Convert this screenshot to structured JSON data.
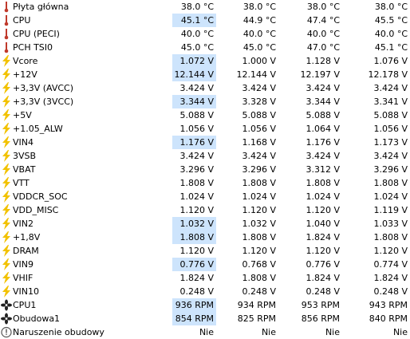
{
  "colors": {
    "highlight": "#cde4fc",
    "temperature_icon": "#c0392b",
    "voltage_icon": "#f2c200",
    "fan_icon": "#222222"
  },
  "rows": [
    {
      "name": "Płyta główna",
      "icon": "thermometer-icon",
      "highlighted": false,
      "values": [
        "38.0 °C",
        "38.0 °C",
        "38.0 °C",
        "38.0 °C"
      ]
    },
    {
      "name": "CPU",
      "icon": "thermometer-icon",
      "highlighted": true,
      "values": [
        "45.1 °C",
        "44.9 °C",
        "47.4 °C",
        "45.5 °C"
      ]
    },
    {
      "name": "CPU (PECI)",
      "icon": "thermometer-icon",
      "highlighted": false,
      "values": [
        "40.0 °C",
        "40.0 °C",
        "40.0 °C",
        "40.0 °C"
      ]
    },
    {
      "name": "PCH TSI0",
      "icon": "thermometer-icon",
      "highlighted": false,
      "values": [
        "45.0 °C",
        "45.0 °C",
        "47.0 °C",
        "45.1 °C"
      ]
    },
    {
      "name": "Vcore",
      "icon": "lightning-icon",
      "highlighted": true,
      "values": [
        "1.072 V",
        "1.000 V",
        "1.128 V",
        "1.076 V"
      ]
    },
    {
      "name": "+12V",
      "icon": "lightning-icon",
      "highlighted": true,
      "values": [
        "12.144 V",
        "12.144 V",
        "12.197 V",
        "12.178 V"
      ]
    },
    {
      "name": "+3,3V (AVCC)",
      "icon": "lightning-icon",
      "highlighted": false,
      "values": [
        "3.424 V",
        "3.424 V",
        "3.424 V",
        "3.424 V"
      ]
    },
    {
      "name": "+3,3V (3VCC)",
      "icon": "lightning-icon",
      "highlighted": true,
      "values": [
        "3.344 V",
        "3.328 V",
        "3.344 V",
        "3.341 V"
      ]
    },
    {
      "name": "+5V",
      "icon": "lightning-icon",
      "highlighted": false,
      "values": [
        "5.088 V",
        "5.088 V",
        "5.088 V",
        "5.088 V"
      ]
    },
    {
      "name": "+1.05_ALW",
      "icon": "lightning-icon",
      "highlighted": false,
      "values": [
        "1.056 V",
        "1.056 V",
        "1.064 V",
        "1.056 V"
      ]
    },
    {
      "name": "VIN4",
      "icon": "lightning-icon",
      "highlighted": true,
      "values": [
        "1.176 V",
        "1.168 V",
        "1.176 V",
        "1.173 V"
      ]
    },
    {
      "name": "3VSB",
      "icon": "lightning-icon",
      "highlighted": false,
      "values": [
        "3.424 V",
        "3.424 V",
        "3.424 V",
        "3.424 V"
      ]
    },
    {
      "name": "VBAT",
      "icon": "lightning-icon",
      "highlighted": false,
      "values": [
        "3.296 V",
        "3.296 V",
        "3.312 V",
        "3.296 V"
      ]
    },
    {
      "name": "VTT",
      "icon": "lightning-icon",
      "highlighted": false,
      "values": [
        "1.808 V",
        "1.808 V",
        "1.808 V",
        "1.808 V"
      ]
    },
    {
      "name": "VDDCR_SOC",
      "icon": "lightning-icon",
      "highlighted": false,
      "values": [
        "1.024 V",
        "1.024 V",
        "1.024 V",
        "1.024 V"
      ]
    },
    {
      "name": "VDD_MISC",
      "icon": "lightning-icon",
      "highlighted": false,
      "values": [
        "1.120 V",
        "1.120 V",
        "1.120 V",
        "1.119 V"
      ]
    },
    {
      "name": "VIN2",
      "icon": "lightning-icon",
      "highlighted": true,
      "values": [
        "1.032 V",
        "1.032 V",
        "1.040 V",
        "1.033 V"
      ]
    },
    {
      "name": "+1,8V",
      "icon": "lightning-icon",
      "highlighted": true,
      "values": [
        "1.808 V",
        "1.808 V",
        "1.824 V",
        "1.808 V"
      ]
    },
    {
      "name": "DRAM",
      "icon": "lightning-icon",
      "highlighted": false,
      "values": [
        "1.120 V",
        "1.120 V",
        "1.120 V",
        "1.120 V"
      ]
    },
    {
      "name": "VIN9",
      "icon": "lightning-icon",
      "highlighted": true,
      "values": [
        "0.776 V",
        "0.768 V",
        "0.776 V",
        "0.774 V"
      ]
    },
    {
      "name": "VHIF",
      "icon": "lightning-icon",
      "highlighted": false,
      "values": [
        "1.824 V",
        "1.808 V",
        "1.824 V",
        "1.824 V"
      ]
    },
    {
      "name": "VIN10",
      "icon": "lightning-icon",
      "highlighted": false,
      "values": [
        "0.248 V",
        "0.248 V",
        "0.248 V",
        "0.248 V"
      ]
    },
    {
      "name": "CPU1",
      "icon": "fan-icon",
      "highlighted": true,
      "values": [
        "936 RPM",
        "934 RPM",
        "953 RPM",
        "943 RPM"
      ]
    },
    {
      "name": "Obudowa1",
      "icon": "fan-icon",
      "highlighted": true,
      "values": [
        "854 RPM",
        "825 RPM",
        "856 RPM",
        "840 RPM"
      ]
    },
    {
      "name": "Naruszenie obudowy",
      "icon": "intrusion-icon",
      "highlighted": false,
      "values": [
        "Nie",
        "Nie",
        "Nie",
        "Nie"
      ]
    }
  ]
}
